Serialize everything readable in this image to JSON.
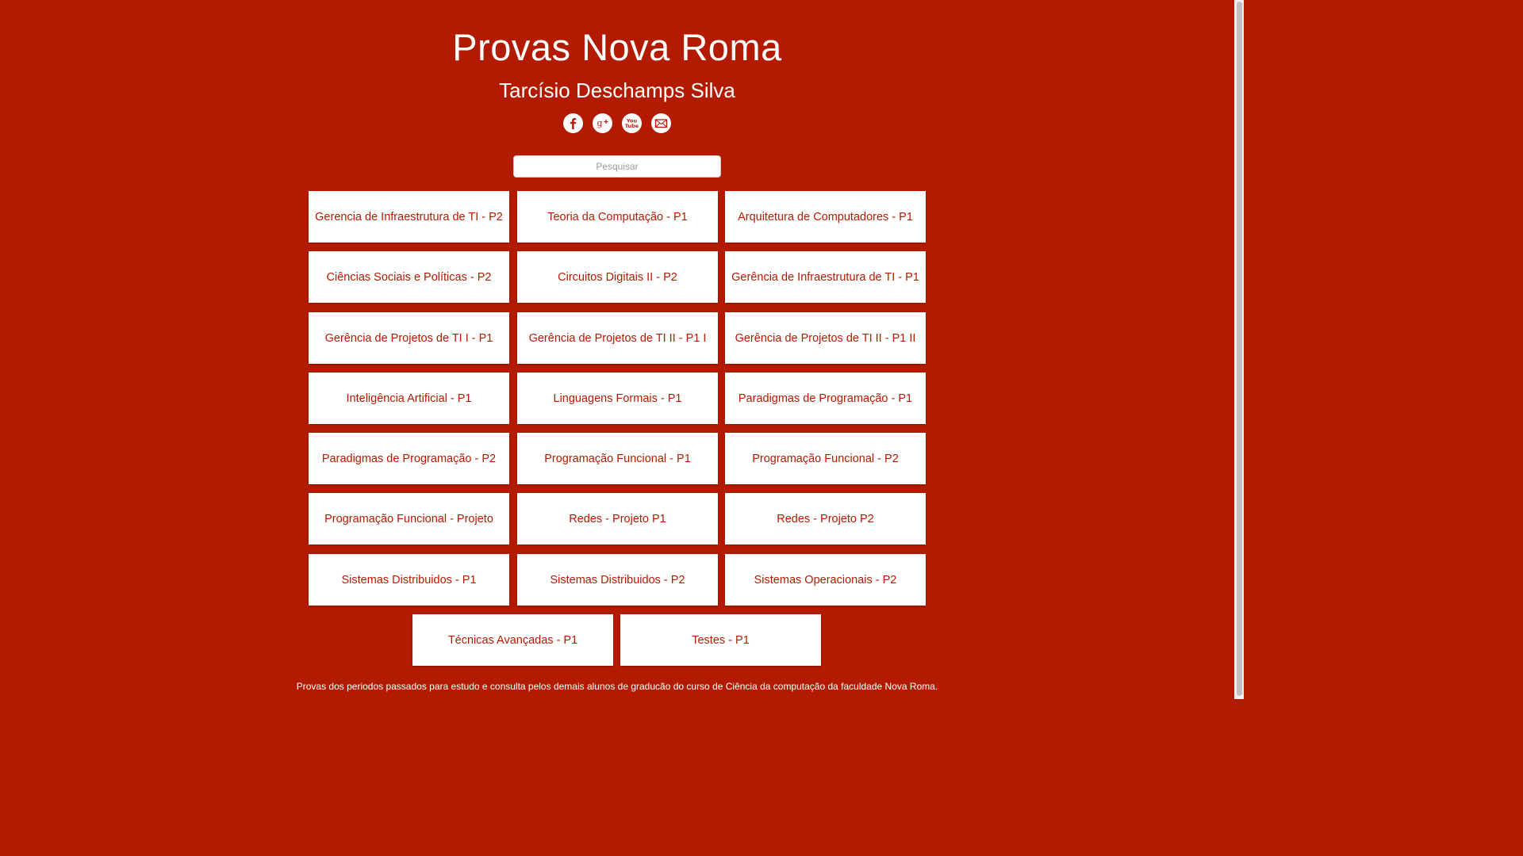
{
  "header": {
    "title": "Provas Nova Roma",
    "subtitle": "Tarcísio Deschamps Silva"
  },
  "social": [
    {
      "icon": "facebook-icon"
    },
    {
      "icon": "google-plus-icon"
    },
    {
      "icon": "youtube-icon"
    },
    {
      "icon": "email-icon"
    }
  ],
  "search": {
    "placeholder": "Pesquisar",
    "value": ""
  },
  "exams": [
    {
      "label": "Gerencia de Infraestrutura de TI - P2"
    },
    {
      "label": "Teoria da Computação - P1"
    },
    {
      "label": "Arquitetura de Computadores - P1"
    },
    {
      "label": "Ciências Sociais e Políticas - P2"
    },
    {
      "label": "Circuitos Digitais II - P2"
    },
    {
      "label": "Gerência de Infraestrutura de TI - P1"
    },
    {
      "label": "Gerência de Projetos de TI I - P1"
    },
    {
      "label": "Gerência de Projetos de TI II - P1 I"
    },
    {
      "label": "Gerência de Projetos de TI II - P1 II"
    },
    {
      "label": "Inteligência Artificial - P1"
    },
    {
      "label": "Linguagens Formais - P1"
    },
    {
      "label": "Paradigmas de Programação - P1"
    },
    {
      "label": "Paradigmas de Programação - P2"
    },
    {
      "label": "Programação Funcional - P1"
    },
    {
      "label": "Programação Funcional - P2"
    },
    {
      "label": "Programação Funcional - Projeto"
    },
    {
      "label": "Redes - Projeto P1"
    },
    {
      "label": "Redes - Projeto P2"
    },
    {
      "label": "Sistemas Distribuidos - P1"
    },
    {
      "label": "Sistemas Distribuidos - P2"
    },
    {
      "label": "Sistemas Operacionais - P2"
    },
    {
      "label": "Técnicas Avançadas - P1"
    },
    {
      "label": "Testes - P1"
    }
  ],
  "footer": {
    "text": "Provas dos periodos passados para estudo e consulta pelos demais alunos de graducão do curso de Ciência da computação da faculdade Nova Roma."
  },
  "colors": {
    "background": "#b31b00",
    "card": "#ffffff",
    "card_text": "#b31b00"
  }
}
